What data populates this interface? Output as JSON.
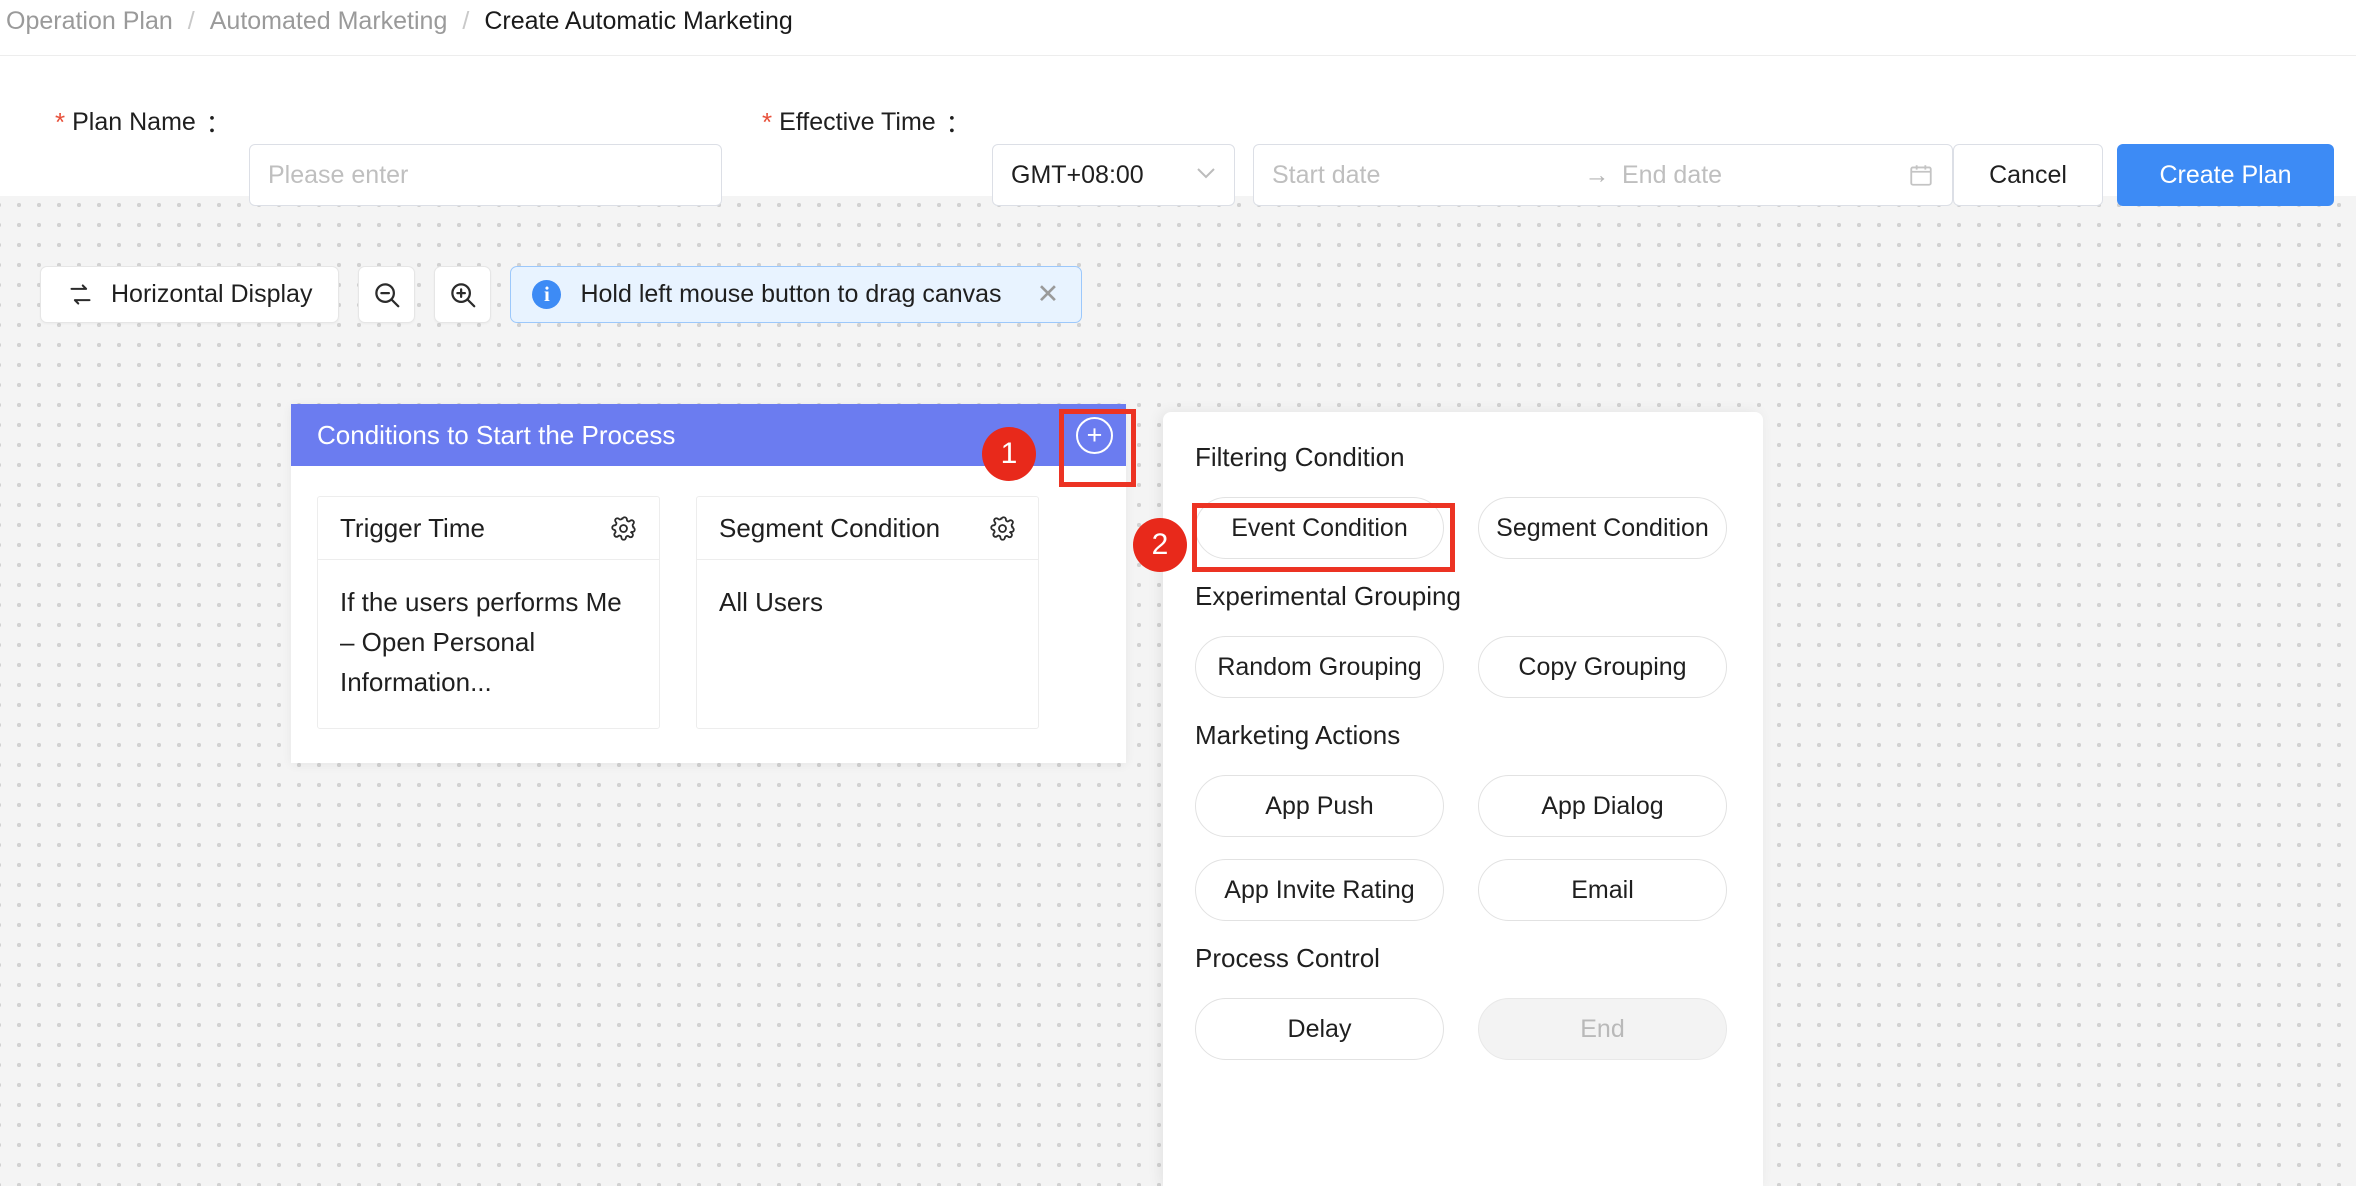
{
  "breadcrumb": {
    "items": [
      "Operation Plan",
      "Automated Marketing",
      "Create Automatic Marketing"
    ],
    "separator": "/"
  },
  "form": {
    "plan_name": {
      "label": "Plan Name",
      "required_mark": "*",
      "colon": "：",
      "value": "",
      "placeholder": "Please enter"
    },
    "effective_time": {
      "label": "Effective Time",
      "required_mark": "*",
      "colon": "："
    },
    "timezone": {
      "value": "GMT+08:00",
      "chevron": "∨"
    },
    "date_range": {
      "start_placeholder": "Start date",
      "end_placeholder": "End date",
      "arrow": "→",
      "icon": "calendar-icon"
    },
    "cancel_label": "Cancel",
    "create_label": "Create Plan",
    "accent_color": "#3d8bf5",
    "required_color": "#e8503a"
  },
  "toolbar": {
    "horizontal_display": {
      "label": "Horizontal Display",
      "icon": "swap-arrows-icon"
    },
    "zoom_out": {
      "icon": "zoom-out-icon"
    },
    "zoom_in": {
      "icon": "zoom-in-icon"
    },
    "tip": {
      "icon": "info-icon",
      "text": "Hold left mouse button to drag canvas",
      "close": "✕"
    }
  },
  "node": {
    "title": "Conditions to Start the Process",
    "header_color": "#6b7cf0",
    "add_button": {
      "icon": "plus-circle-icon",
      "glyph": "+"
    },
    "cards": [
      {
        "title": "Trigger Time",
        "icon": "gear-icon",
        "body": "If the users performs Me – Open Personal Information..."
      },
      {
        "title": "Segment Condition",
        "icon": "gear-icon",
        "body": "All Users"
      }
    ]
  },
  "panel": {
    "sections": [
      {
        "title": "Filtering Condition",
        "options": [
          {
            "label": "Event Condition",
            "disabled": false
          },
          {
            "label": "Segment Condition",
            "disabled": false
          }
        ]
      },
      {
        "title": "Experimental Grouping",
        "options": [
          {
            "label": "Random Grouping",
            "disabled": false
          },
          {
            "label": "Copy Grouping",
            "disabled": false
          }
        ]
      },
      {
        "title": "Marketing Actions",
        "options": [
          {
            "label": "App Push",
            "disabled": false
          },
          {
            "label": "App Dialog",
            "disabled": false
          },
          {
            "label": "App Invite Rating",
            "disabled": false
          },
          {
            "label": "Email",
            "disabled": false
          }
        ]
      },
      {
        "title": "Process Control",
        "options": [
          {
            "label": "Delay",
            "disabled": false
          },
          {
            "label": "End",
            "disabled": true
          }
        ]
      }
    ]
  },
  "annotations": {
    "color": "#ec3323",
    "badges": [
      {
        "number": "1",
        "target": "node-add-button"
      },
      {
        "number": "2",
        "target": "event-condition-option"
      }
    ]
  }
}
